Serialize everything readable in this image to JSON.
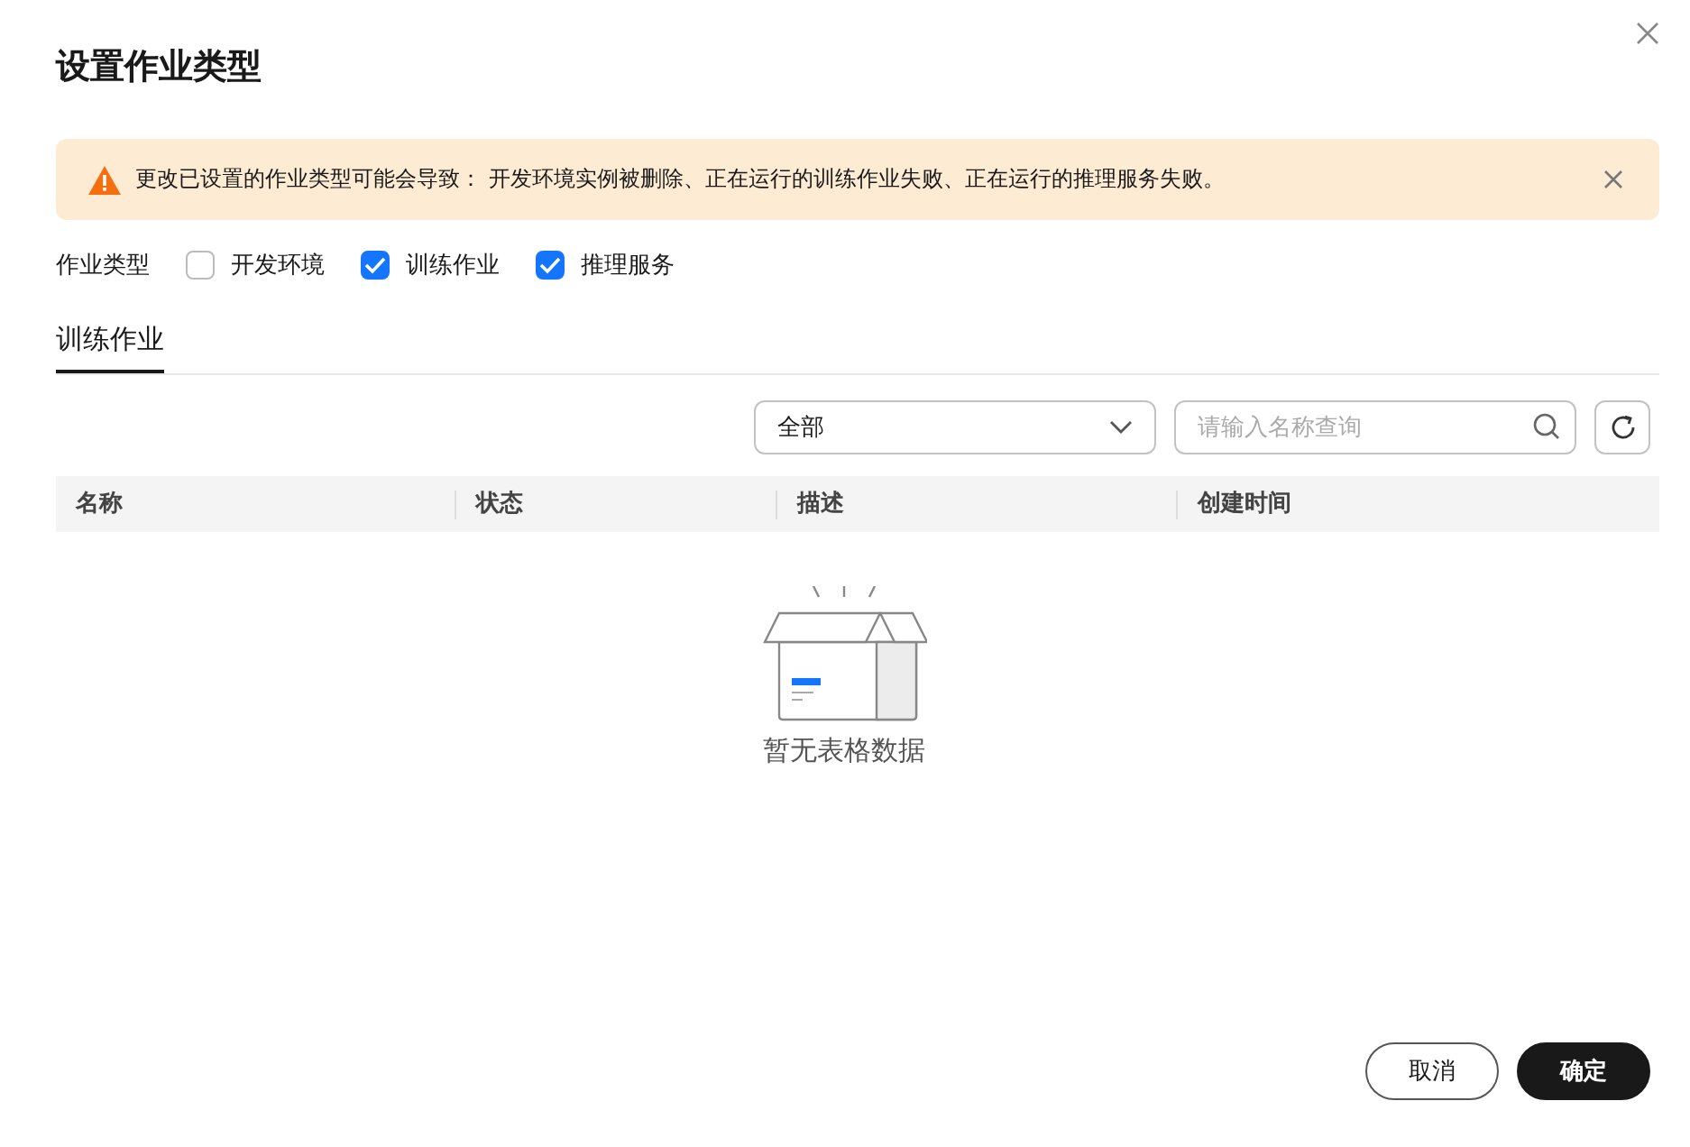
{
  "dialog": {
    "title": "设置作业类型"
  },
  "alert": {
    "message": "更改已设置的作业类型可能会导致： 开发环境实例被删除、正在运行的训练作业失败、正在运行的推理服务失败。"
  },
  "job_types": {
    "label": "作业类型",
    "options": [
      {
        "label": "开发环境",
        "checked": false
      },
      {
        "label": "训练作业",
        "checked": true
      },
      {
        "label": "推理服务",
        "checked": true
      }
    ]
  },
  "tabs": [
    {
      "label": "训练作业",
      "selected": true
    }
  ],
  "filter": {
    "value": "全部"
  },
  "search": {
    "placeholder": "请输入名称查询"
  },
  "table": {
    "columns": [
      "名称",
      "状态",
      "描述",
      "创建时间"
    ],
    "empty_text": "暂无表格数据"
  },
  "buttons": [
    {
      "label": "取消",
      "kind": "secondary"
    },
    {
      "label": "确定",
      "kind": "primary"
    }
  ]
}
